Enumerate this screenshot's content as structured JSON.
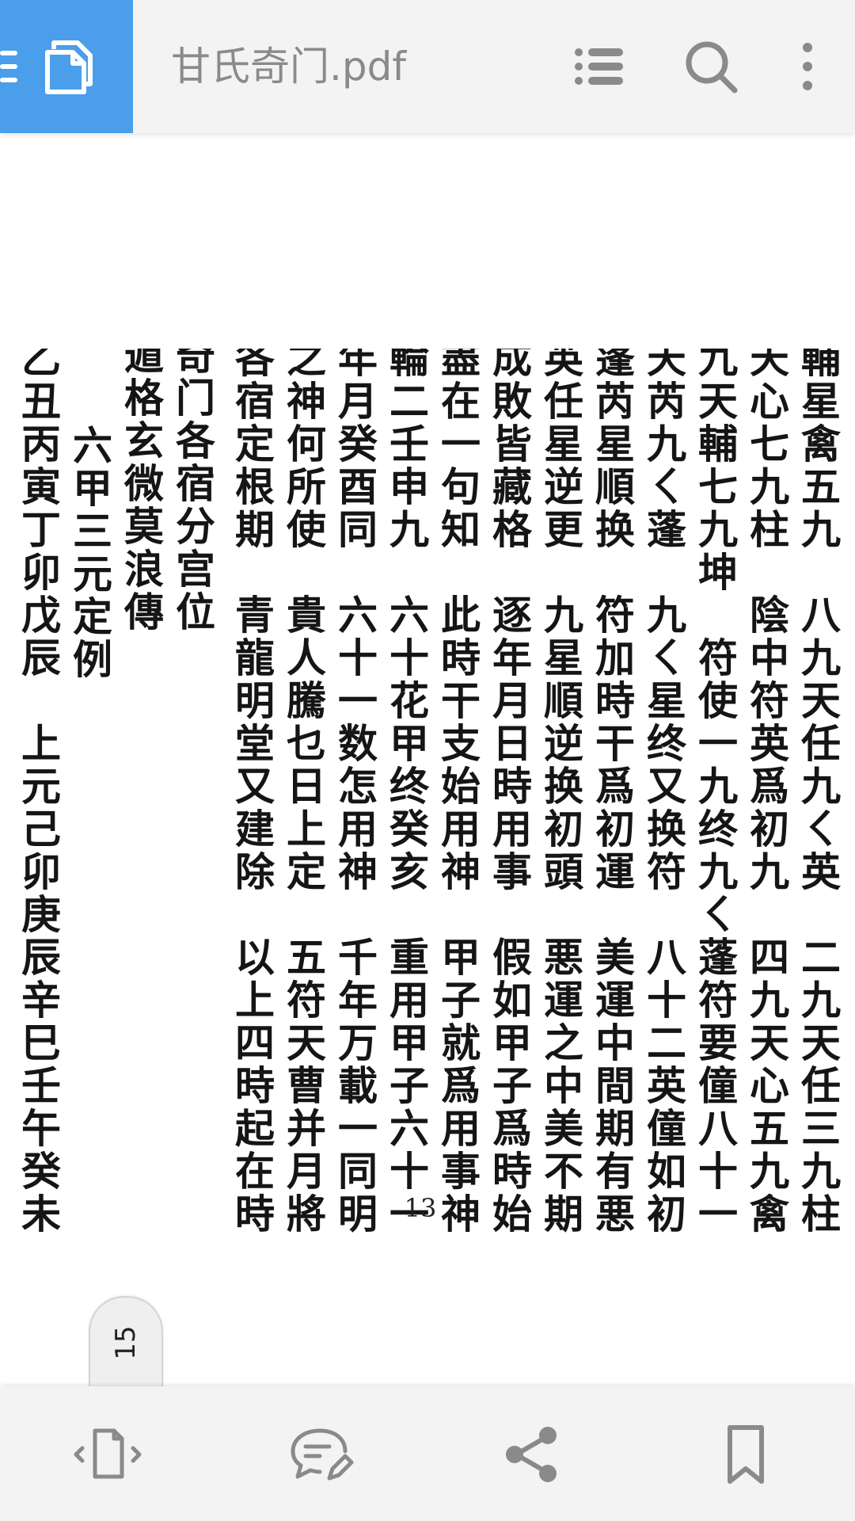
{
  "toolbar": {
    "title": "甘氏奇门.pdf",
    "icons": {
      "menu": "menu-icon",
      "document": "copy-document-icon",
      "outline": "list-icon",
      "search": "search-icon",
      "more": "more-vertical-icon"
    }
  },
  "document": {
    "columns": [
      "四九輔星禽五九　八九天任九ㄑ英　二九天任三九柱",
      "六九天心七九柱　陰中符英爲初九　四九天心五九禽",
      "六九天輔七九坤　符使一九终九ㄑ蓬符要僮八十一",
      "八九天芮九ㄑ蓬　九ㄑ星终又换符　八十二英僮如初",
      "陽遁蓬芮星順换　符加時干爲初運　美運中間期有悪",
      "陰遁英任星逆更　九星順逆换初頭　悪運之中美不期",
      "許多成敗皆藏格　逐年月日時用事　假如甲子爲時始",
      "萬事盡在一句知　此時干支始用神　甲子就爲用事神",
      "乙丑輪二壬申九　六十花甲终癸亥　重用甲子六十一",
      "十時年月癸酉同　六十一数怎用神　千年万載一同明",
      "用事之神何所使　貴人騰乜日上定　五符天曹并月將",
      "諸星各宿定根期　青龍明堂又建除　以上四時起在時",
      "奇门各宿分宫位",
      "遁格玄微莫浪傳",
      "六甲三元定例",
      "上元甲子乙丑丙寅丁卯戊辰　上元己卯庚辰辛巳壬午癸未"
    ],
    "page_number": "13"
  },
  "page_badge": {
    "current_page": "15"
  },
  "bottombar": {
    "icons": {
      "convert": "convert-document-icon",
      "comment": "comment-edit-icon",
      "share": "share-icon",
      "bookmark": "bookmark-icon"
    }
  },
  "colors": {
    "accent": "#4a9eea",
    "toolbar_bg": "#f3f3f3",
    "icon_gray": "#8a8a8a",
    "ink": "#151515"
  }
}
